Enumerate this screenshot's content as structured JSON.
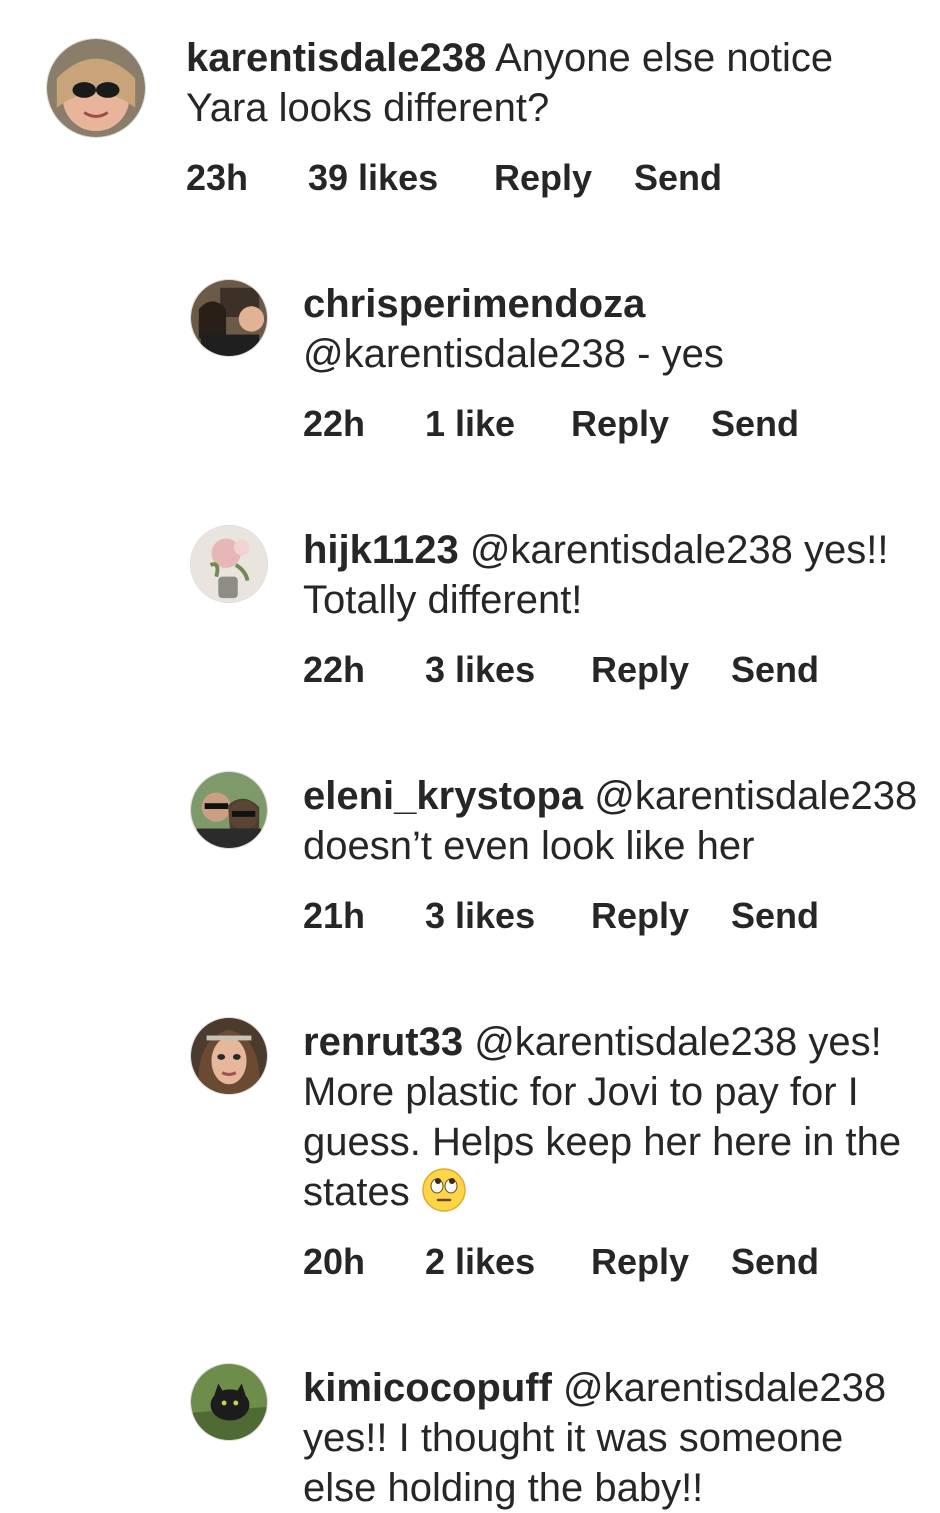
{
  "comments": [
    {
      "username": "karentisdale238",
      "body": "Anyone else notice Yara looks different?",
      "time": "23h",
      "likes": "39 likes",
      "reply": "Reply",
      "send": "Send"
    },
    {
      "username": "chrisperimendoza",
      "body": "@karentisdale238 - yes",
      "time": "22h",
      "likes": "1 like",
      "reply": "Reply",
      "send": "Send"
    },
    {
      "username": "hijk1123",
      "body": "@karentisdale238 yes!! Totally different!",
      "time": "22h",
      "likes": "3 likes",
      "reply": "Reply",
      "send": "Send"
    },
    {
      "username": "eleni_krystopa",
      "body": "@karentisdale238 doesn’t even look like her",
      "time": "21h",
      "likes": "3 likes",
      "reply": "Reply",
      "send": "Send"
    },
    {
      "username": "renrut33",
      "body": "@karentisdale238 yes! More plastic for Jovi to pay for I guess. Helps keep her here in the states",
      "emoji": "eye-roll-emoji",
      "time": "20h",
      "likes": "2 likes",
      "reply": "Reply",
      "send": "Send"
    },
    {
      "username": "kimicocopuff",
      "body": "@karentisdale238 yes!! I thought it was someone else holding the baby!!"
    }
  ]
}
